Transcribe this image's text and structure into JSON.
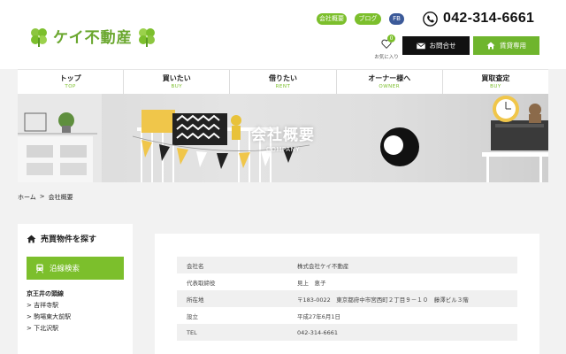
{
  "logo": {
    "text": "ケイ不動産"
  },
  "header": {
    "top_links": [
      "会社概要",
      "ブログ",
      "FB"
    ],
    "phone": "042-314-6661",
    "favorites": {
      "label": "お気に入り",
      "count": "0"
    },
    "contact_label": "お問合せ",
    "rent_label": "賃貸専用"
  },
  "nav": [
    {
      "jp": "トップ",
      "en": "TOP"
    },
    {
      "jp": "買いたい",
      "en": "BUY"
    },
    {
      "jp": "借りたい",
      "en": "RENT"
    },
    {
      "jp": "オーナー様へ",
      "en": "OWNER"
    },
    {
      "jp": "買取査定",
      "en": "BUY"
    }
  ],
  "hero": {
    "title": "会社概要",
    "subtitle": "COMPANY"
  },
  "breadcrumb": {
    "home": "ホーム",
    "separator": ">",
    "current": "会社概要"
  },
  "sidebar": {
    "title": "売買物件を探す",
    "line_search_label": "沿線検索",
    "line_name": "京王井の頭線",
    "stations": [
      "> 吉祥寺駅",
      "> 駒場東大前駅",
      "> 下北沢駅"
    ]
  },
  "company": {
    "rows": [
      {
        "key": "会社名",
        "value": "株式会社ケイ不動産"
      },
      {
        "key": "代表取締役",
        "value": "見上　恵子"
      },
      {
        "key": "所在地",
        "value": "〒183-0022　東京都府中市宮西町２丁目９－１０　藤澤ビル３階"
      },
      {
        "key": "設立",
        "value": "平成27年6月1日"
      },
      {
        "key": "TEL",
        "value": "042-314-6661"
      }
    ]
  },
  "colors": {
    "brand_green": "#7cbf2c",
    "fb_blue": "#3c5a99"
  }
}
